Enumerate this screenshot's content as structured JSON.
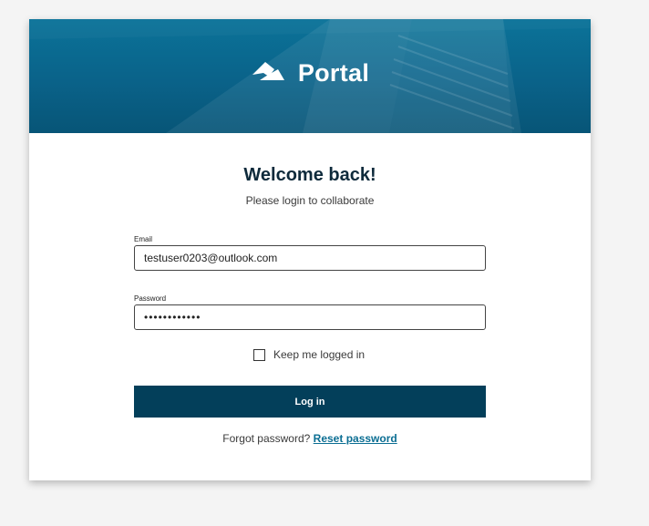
{
  "brand": {
    "name": "Portal",
    "logo_icon": "portal-logo-icon"
  },
  "colors": {
    "banner": "#0a6289",
    "primary_button": "#033f5a",
    "link": "#0b6e93",
    "page_background": "#f4f4f4"
  },
  "heading": {
    "title": "Welcome back!",
    "subtitle": "Please login to collaborate"
  },
  "form": {
    "email": {
      "label": "Email",
      "value": "testuser0203@outlook.com"
    },
    "password": {
      "label": "Password",
      "value": "••••••••••••"
    },
    "remember": {
      "label": "Keep me logged in",
      "checked": false
    },
    "submit_label": "Log in"
  },
  "footer": {
    "forgot_text": "Forgot password?",
    "reset_link": "Reset password"
  }
}
